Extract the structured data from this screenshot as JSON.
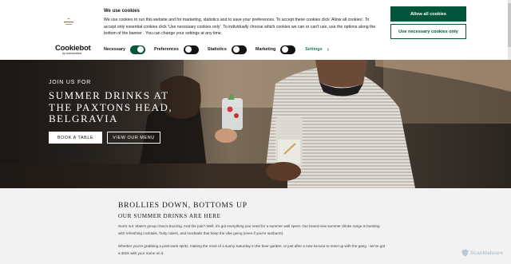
{
  "cookie_banner": {
    "title": "We use cookies",
    "text": "We use cookies to run this website and for marketing, statistics and to save your preferences. To accept these cookies click 'Allow all cookies'. To accept only essential cookies click 'Use necessary cookies only'. To individually choose which cookies we can or can't use, use the options along the bottom of the banner . You can change your settings at any time.",
    "logo_main": "Cookiebot",
    "logo_sub": "by Usercentrics",
    "toggles": [
      {
        "label": "Necessary",
        "on": true
      },
      {
        "label": "Preferences",
        "on": false
      },
      {
        "label": "Statistics",
        "on": false
      },
      {
        "label": "Marketing",
        "on": false
      }
    ],
    "settings_label": "Settings",
    "allow_all_label": "Allow all cookies",
    "necessary_only_label": "Use necessary cookies only",
    "accent_color": "#00553a"
  },
  "hero": {
    "kicker": "JOIN US FOR",
    "title": "SUMMER DRINKS AT THE PAXTONS HEAD, BELGRAVIA",
    "book_label": "BOOK A TABLE",
    "menu_label": "VIEW OUR MENU"
  },
  "content": {
    "heading": "BROLLIES DOWN, BOTTOMS UP",
    "subheading": "OUR SUMMER DRINKS ARE HERE",
    "para1": "Sun's out. Mate's group chat is buzzing. And the pub? Well, it's got everything you need for a summer well spent. Our brand-new summer drinks range is bursting with refreshing cocktails, fruity ciders, and mocktails that keep the vibe going (even if you're sunburnt).",
    "para2": "Whether you're grabbing a post-work spritz, making the most of a sunny Saturday in the beer garden, or just after a new excuse to meet up with the gang - we've got a drink with your name on it."
  },
  "watermark": "ScanMalware"
}
